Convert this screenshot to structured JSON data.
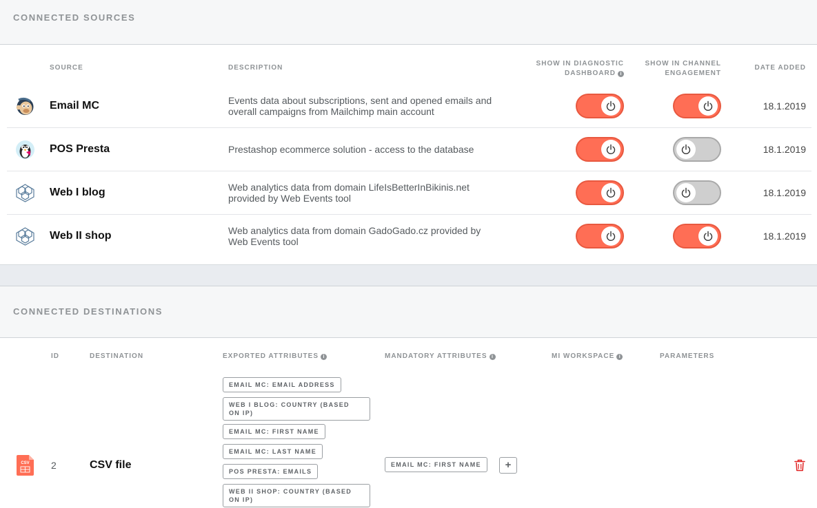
{
  "sources": {
    "title": "CONNECTED SOURCES",
    "headers": {
      "source": "SOURCE",
      "description": "DESCRIPTION",
      "diagnostic_line1": "SHOW IN DIAGNOSTIC",
      "diagnostic_line2": "DASHBOARD",
      "channel_line1": "SHOW IN CHANNEL",
      "channel_line2": "ENGAGEMENT",
      "date": "DATE ADDED"
    },
    "rows": [
      {
        "name": "Email MC",
        "icon": "mailchimp-icon",
        "desc1": "Events data about subscriptions, sent and opened emails and",
        "desc2": "overall campaigns from Mailchimp main account",
        "diagnostic": true,
        "channel": true,
        "date": "18.1.2019"
      },
      {
        "name": "POS Presta",
        "icon": "prestashop-icon",
        "desc1": "Prestashop ecommerce solution - access to the database",
        "desc2": "",
        "diagnostic": true,
        "channel": false,
        "date": "18.1.2019"
      },
      {
        "name": "Web I blog",
        "icon": "web-events-icon",
        "desc1": "Web analytics data from domain LifeIsBetterInBikinis.net",
        "desc2": "provided by Web Events tool",
        "diagnostic": true,
        "channel": false,
        "date": "18.1.2019"
      },
      {
        "name": "Web II shop",
        "icon": "web-events-icon",
        "desc1": "Web analytics data from domain GadoGado.cz provided by",
        "desc2": "Web Events tool",
        "diagnostic": true,
        "channel": true,
        "date": "18.1.2019"
      }
    ]
  },
  "destinations": {
    "title": "CONNECTED DESTINATIONS",
    "headers": {
      "id": "ID",
      "destination": "DESTINATION",
      "exported": "EXPORTED ATTRIBUTES",
      "mandatory": "MANDATORY ATTRIBUTES",
      "workspace": "MI WORKSPACE",
      "parameters": "PARAMETERS"
    },
    "rows": [
      {
        "id": "2",
        "name": "CSV file",
        "icon": "csv-file-icon",
        "icon_label": "CSV",
        "exported": [
          {
            "l1": "EMAIL MC: EMAIL ADDRESS",
            "l2": ""
          },
          {
            "l1": "WEB I BLOG: COUNTRY (BASED",
            "l2": "ON IP)"
          },
          {
            "l1": "EMAIL MC: FIRST NAME",
            "l2": ""
          },
          {
            "l1": "EMAIL MC: LAST NAME",
            "l2": ""
          },
          {
            "l1": "POS PRESTA: EMAILS",
            "l2": ""
          },
          {
            "l1": "WEB II SHOP: COUNTRY (BASED",
            "l2": "ON IP)"
          }
        ],
        "mandatory": [
          "EMAIL MC: FIRST NAME"
        ],
        "add_label": "+",
        "delete_icon": "trash-icon"
      }
    ]
  },
  "colors": {
    "accent": "#ff6e55",
    "toggle_off": "#cfcfcf",
    "delete": "#e02020",
    "header_text": "#8f9396"
  },
  "info_glyph": "i"
}
